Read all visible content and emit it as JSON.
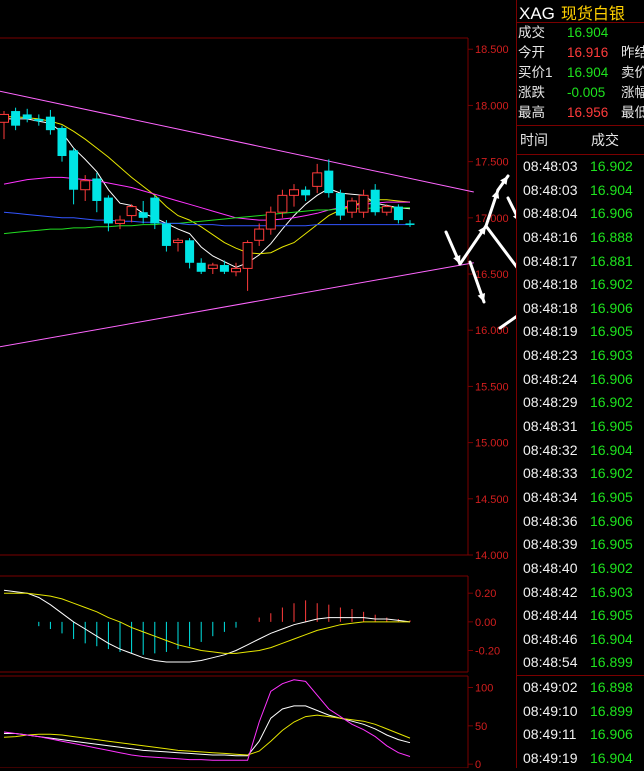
{
  "header": {
    "symbol": "XAG",
    "name": "现货白银"
  },
  "quote": {
    "rows": [
      {
        "label": "成交",
        "value": "16.904",
        "color": "#1ee31e",
        "label2": ""
      },
      {
        "label": "今开",
        "value": "16.916",
        "color": "#ff3b3b",
        "label2": "昨结"
      },
      {
        "label": "买价1",
        "value": "16.904",
        "color": "#1ee31e",
        "label2": "卖价"
      },
      {
        "label": "涨跌",
        "value": "-0.005",
        "color": "#1ee31e",
        "label2": "涨幅"
      },
      {
        "label": "最高",
        "value": "16.956",
        "color": "#ff3b3b",
        "label2": "最低"
      }
    ]
  },
  "ticks_header": {
    "time": "时间",
    "price": "成交"
  },
  "ticks": [
    {
      "time": "08:48:03",
      "price": "16.902",
      "dir": "dn"
    },
    {
      "time": "08:48:03",
      "price": "16.904",
      "dir": "dn"
    },
    {
      "time": "08:48:04",
      "price": "16.906",
      "dir": "dn"
    },
    {
      "time": "08:48:16",
      "price": "16.888",
      "dir": "dn"
    },
    {
      "time": "08:48:17",
      "price": "16.881",
      "dir": "dn"
    },
    {
      "time": "08:48:18",
      "price": "16.902",
      "dir": "dn"
    },
    {
      "time": "08:48:18",
      "price": "16.906",
      "dir": "dn"
    },
    {
      "time": "08:48:19",
      "price": "16.905",
      "dir": "dn"
    },
    {
      "time": "08:48:23",
      "price": "16.903",
      "dir": "dn"
    },
    {
      "time": "08:48:24",
      "price": "16.906",
      "dir": "dn"
    },
    {
      "time": "08:48:29",
      "price": "16.902",
      "dir": "dn"
    },
    {
      "time": "08:48:31",
      "price": "16.905",
      "dir": "dn"
    },
    {
      "time": "08:48:32",
      "price": "16.904",
      "dir": "dn"
    },
    {
      "time": "08:48:33",
      "price": "16.902",
      "dir": "dn"
    },
    {
      "time": "08:48:34",
      "price": "16.905",
      "dir": "dn"
    },
    {
      "time": "08:48:36",
      "price": "16.906",
      "dir": "dn"
    },
    {
      "time": "08:48:39",
      "price": "16.905",
      "dir": "dn"
    },
    {
      "time": "08:48:40",
      "price": "16.902",
      "dir": "dn"
    },
    {
      "time": "08:48:42",
      "price": "16.903",
      "dir": "dn"
    },
    {
      "time": "08:48:44",
      "price": "16.905",
      "dir": "dn"
    },
    {
      "time": "08:48:46",
      "price": "16.904",
      "dir": "dn"
    },
    {
      "time": "08:48:54",
      "price": "16.899",
      "dir": "dn"
    },
    {
      "time": "08:49:02",
      "price": "16.898",
      "dir": "dn"
    },
    {
      "time": "08:49:10",
      "price": "16.899",
      "dir": "dn"
    },
    {
      "time": "08:49:11",
      "price": "16.906",
      "dir": "dn"
    },
    {
      "time": "08:49:19",
      "price": "16.904",
      "dir": "dn"
    }
  ],
  "colors": {
    "up": "#ff3b3b",
    "down": "#00e5e5",
    "grid": "#7a0000",
    "axis_text": "#d21e1e",
    "ma5": "#ffffff",
    "ma10": "#e6e600",
    "ma20": "#ff33ff",
    "ma60": "#22dd22",
    "ma120": "#3355ff",
    "trendline": "#ff66ff",
    "arrow": "#ffffff"
  },
  "chart_data": [
    {
      "type": "candlestick",
      "ylim": [
        14.0,
        18.6
      ],
      "ticks": [
        "18.500",
        "18.000",
        "17.500",
        "17.000",
        "16.500",
        "16.000",
        "15.500",
        "15.000",
        "14.500",
        "14.000"
      ],
      "tick_values": [
        18.5,
        18.0,
        17.5,
        17.0,
        16.5,
        16.0,
        15.5,
        15.0,
        14.5,
        14.0
      ],
      "candles": [
        {
          "o": 17.85,
          "h": 17.95,
          "l": 17.7,
          "c": 17.92
        },
        {
          "o": 17.95,
          "h": 17.98,
          "l": 17.78,
          "c": 17.82
        },
        {
          "o": 17.92,
          "h": 17.97,
          "l": 17.85,
          "c": 17.88
        },
        {
          "o": 17.88,
          "h": 17.92,
          "l": 17.82,
          "c": 17.86
        },
        {
          "o": 17.9,
          "h": 17.96,
          "l": 17.74,
          "c": 17.78
        },
        {
          "o": 17.8,
          "h": 17.82,
          "l": 17.5,
          "c": 17.55
        },
        {
          "o": 17.6,
          "h": 17.62,
          "l": 17.12,
          "c": 17.25
        },
        {
          "o": 17.25,
          "h": 17.38,
          "l": 17.15,
          "c": 17.33
        },
        {
          "o": 17.35,
          "h": 17.4,
          "l": 17.05,
          "c": 17.15
        },
        {
          "o": 17.18,
          "h": 17.2,
          "l": 16.88,
          "c": 16.95
        },
        {
          "o": 16.95,
          "h": 17.02,
          "l": 16.9,
          "c": 16.98
        },
        {
          "o": 17.02,
          "h": 17.12,
          "l": 16.96,
          "c": 17.1
        },
        {
          "o": 17.05,
          "h": 17.15,
          "l": 16.95,
          "c": 17.0
        },
        {
          "o": 17.18,
          "h": 17.2,
          "l": 16.9,
          "c": 16.95
        },
        {
          "o": 16.95,
          "h": 16.98,
          "l": 16.7,
          "c": 16.75
        },
        {
          "o": 16.78,
          "h": 16.82,
          "l": 16.7,
          "c": 16.8
        },
        {
          "o": 16.8,
          "h": 16.82,
          "l": 16.55,
          "c": 16.6
        },
        {
          "o": 16.6,
          "h": 16.64,
          "l": 16.5,
          "c": 16.52
        },
        {
          "o": 16.55,
          "h": 16.6,
          "l": 16.5,
          "c": 16.58
        },
        {
          "o": 16.58,
          "h": 16.62,
          "l": 16.5,
          "c": 16.52
        },
        {
          "o": 16.52,
          "h": 16.6,
          "l": 16.48,
          "c": 16.55
        },
        {
          "o": 16.55,
          "h": 16.8,
          "l": 16.35,
          "c": 16.78
        },
        {
          "o": 16.8,
          "h": 16.95,
          "l": 16.75,
          "c": 16.9
        },
        {
          "o": 16.9,
          "h": 17.1,
          "l": 16.85,
          "c": 17.05
        },
        {
          "o": 17.05,
          "h": 17.25,
          "l": 17.0,
          "c": 17.2
        },
        {
          "o": 17.2,
          "h": 17.3,
          "l": 17.1,
          "c": 17.25
        },
        {
          "o": 17.25,
          "h": 17.28,
          "l": 17.15,
          "c": 17.2
        },
        {
          "o": 17.28,
          "h": 17.48,
          "l": 17.22,
          "c": 17.4
        },
        {
          "o": 17.42,
          "h": 17.52,
          "l": 17.18,
          "c": 17.22
        },
        {
          "o": 17.22,
          "h": 17.25,
          "l": 16.98,
          "c": 17.02
        },
        {
          "o": 17.05,
          "h": 17.18,
          "l": 17.0,
          "c": 17.15
        },
        {
          "o": 17.05,
          "h": 17.25,
          "l": 17.0,
          "c": 17.2
        },
        {
          "o": 17.25,
          "h": 17.3,
          "l": 17.02,
          "c": 17.05
        },
        {
          "o": 17.05,
          "h": 17.12,
          "l": 17.02,
          "c": 17.1
        },
        {
          "o": 17.1,
          "h": 17.12,
          "l": 16.95,
          "c": 16.98
        },
        {
          "o": 16.95,
          "h": 16.98,
          "l": 16.92,
          "c": 16.94
        }
      ],
      "ma_lines": [
        {
          "name": "MA5",
          "color_key": "ma5",
          "values": [
            17.88,
            17.88,
            17.88,
            17.86,
            17.84,
            17.76,
            17.62,
            17.52,
            17.41,
            17.25,
            17.13,
            17.11,
            17.04,
            17.0,
            16.95,
            16.9,
            16.86,
            16.74,
            16.66,
            16.61,
            16.56,
            16.6,
            16.67,
            16.77,
            16.9,
            17.02,
            17.12,
            17.2,
            17.26,
            17.22,
            17.21,
            17.2,
            17.13,
            17.11,
            17.09,
            17.08
          ]
        },
        {
          "name": "MA10",
          "color_key": "ma10",
          "values": [
            17.9,
            17.9,
            17.89,
            17.88,
            17.86,
            17.83,
            17.77,
            17.7,
            17.62,
            17.54,
            17.45,
            17.36,
            17.28,
            17.2,
            17.1,
            17.02,
            16.98,
            16.92,
            16.85,
            16.78,
            16.73,
            16.69,
            16.68,
            16.69,
            16.74,
            16.78,
            16.86,
            16.94,
            17.02,
            17.07,
            17.11,
            17.14,
            17.16,
            17.16,
            17.15,
            17.14
          ]
        },
        {
          "name": "MA20",
          "color_key": "ma20",
          "values": [
            17.3,
            17.32,
            17.34,
            17.35,
            17.36,
            17.36,
            17.35,
            17.34,
            17.33,
            17.31,
            17.29,
            17.27,
            17.24,
            17.21,
            17.18,
            17.15,
            17.12,
            17.09,
            17.06,
            17.03,
            17.0,
            16.99,
            16.98,
            16.98,
            16.99,
            17.0,
            17.02,
            17.04,
            17.07,
            17.09,
            17.11,
            17.12,
            17.13,
            17.14,
            17.14,
            17.14
          ]
        },
        {
          "name": "MA60",
          "color_key": "ma60",
          "values": [
            16.86,
            16.87,
            16.88,
            16.89,
            16.9,
            16.9,
            16.91,
            16.91,
            16.92,
            16.92,
            16.93,
            16.93,
            16.94,
            16.94,
            16.95,
            16.95,
            16.96,
            16.97,
            16.98,
            16.99,
            17.0,
            17.01,
            17.02,
            17.03,
            17.04,
            17.05,
            17.06,
            17.07,
            17.07,
            17.08,
            17.08,
            17.08,
            17.09,
            17.09,
            17.09,
            17.09
          ]
        },
        {
          "name": "MA120",
          "color_key": "ma120",
          "values": [
            17.05,
            17.04,
            17.03,
            17.02,
            17.01,
            17.0,
            17.0,
            16.99,
            16.98,
            16.98,
            16.97,
            16.97,
            16.96,
            16.96,
            16.95,
            16.95,
            16.94,
            16.94,
            16.94,
            16.93,
            16.93,
            16.93,
            16.93,
            16.93,
            16.93,
            16.93,
            16.93,
            16.94,
            16.94,
            16.94,
            16.94,
            16.94,
            16.94,
            16.94,
            16.94,
            16.94
          ]
        }
      ],
      "trendlines": [
        {
          "from": {
            "i": -0.5,
            "v": 18.13
          },
          "to": {
            "i": 40.5,
            "v": 17.23
          }
        },
        {
          "from": {
            "i": -0.5,
            "v": 15.85
          },
          "to": {
            "i": 40.5,
            "v": 16.6
          }
        }
      ]
    },
    {
      "type": "macd",
      "ylim": [
        -0.35,
        0.32
      ],
      "ticks": [
        "0.20",
        "0.00",
        "-0.20"
      ],
      "tick_values": [
        0.2,
        0.0,
        -0.2
      ],
      "histogram": [
        0.0,
        0.0,
        0.0,
        -0.03,
        -0.05,
        -0.08,
        -0.12,
        -0.15,
        -0.17,
        -0.19,
        -0.21,
        -0.22,
        -0.23,
        -0.22,
        -0.21,
        -0.19,
        -0.17,
        -0.14,
        -0.1,
        -0.07,
        -0.04,
        0.0,
        0.03,
        0.06,
        0.1,
        0.13,
        0.15,
        0.13,
        0.12,
        0.1,
        0.09,
        0.07,
        0.05,
        0.03,
        0.02,
        0.01
      ],
      "dif": [
        0.22,
        0.21,
        0.2,
        0.17,
        0.12,
        0.06,
        0.0,
        -0.05,
        -0.1,
        -0.15,
        -0.19,
        -0.22,
        -0.25,
        -0.27,
        -0.28,
        -0.28,
        -0.28,
        -0.27,
        -0.25,
        -0.23,
        -0.2,
        -0.16,
        -0.12,
        -0.08,
        -0.05,
        -0.02,
        0.0,
        0.02,
        0.03,
        0.03,
        0.03,
        0.03,
        0.02,
        0.02,
        0.01,
        0.0
      ],
      "dea": [
        0.2,
        0.2,
        0.2,
        0.19,
        0.18,
        0.16,
        0.13,
        0.1,
        0.07,
        0.03,
        0.0,
        -0.04,
        -0.07,
        -0.1,
        -0.13,
        -0.16,
        -0.18,
        -0.2,
        -0.21,
        -0.22,
        -0.22,
        -0.21,
        -0.2,
        -0.18,
        -0.15,
        -0.12,
        -0.09,
        -0.06,
        -0.04,
        -0.02,
        -0.01,
        0.0,
        0.0,
        0.0,
        0.0,
        0.0
      ]
    },
    {
      "type": "kdj",
      "ylim": [
        -5,
        115
      ],
      "ticks": [
        "100",
        "50",
        "0"
      ],
      "tick_values": [
        100,
        50,
        0
      ],
      "k": [
        40,
        40,
        38,
        36,
        34,
        32,
        30,
        28,
        26,
        24,
        22,
        20,
        18,
        17,
        16,
        15,
        14,
        13,
        12,
        12,
        11,
        11,
        30,
        60,
        72,
        76,
        76,
        70,
        64,
        60,
        56,
        52,
        46,
        38,
        32,
        28
      ],
      "d": [
        35,
        36,
        38,
        39,
        39,
        38,
        36,
        34,
        32,
        30,
        28,
        26,
        24,
        22,
        20,
        18,
        17,
        16,
        15,
        14,
        13,
        12,
        17,
        30,
        44,
        55,
        62,
        64,
        62,
        60,
        58,
        56,
        52,
        46,
        40,
        34
      ],
      "j": [
        42,
        40,
        38,
        36,
        33,
        30,
        27,
        24,
        21,
        18,
        15,
        12,
        10,
        9,
        8,
        7,
        6,
        6,
        5,
        5,
        5,
        5,
        55,
        95,
        105,
        110,
        108,
        90,
        72,
        62,
        52,
        45,
        36,
        24,
        15,
        10
      ]
    }
  ]
}
